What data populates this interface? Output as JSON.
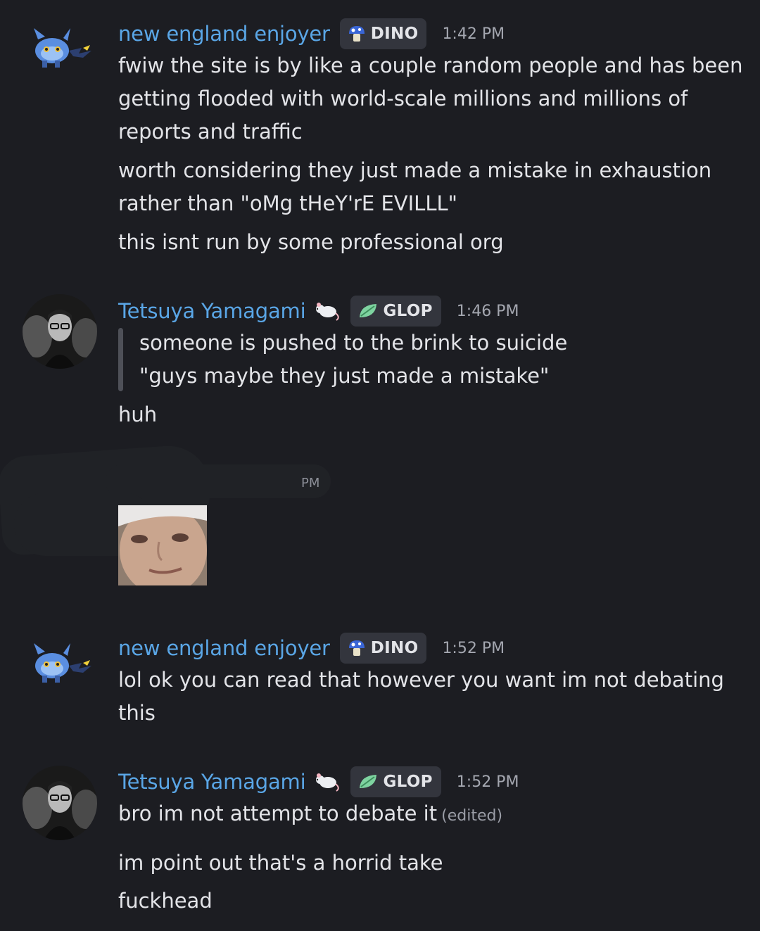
{
  "messages": [
    {
      "username": "new england enjoyer",
      "tag": "DINO",
      "time": "1:42 PM",
      "lines": [
        "fwiw the site is by like a couple random people and has been",
        "getting flooded with world-scale millions and millions of",
        "reports and traffic",
        "worth considering they just made a mistake in exhaustion",
        "rather than \"oMg tHeY'rE EVILLL\"",
        "this isnt run by some professional org"
      ]
    },
    {
      "username": "Tetsuya Yamagami",
      "tag": "GLOP",
      "time": "1:46 PM",
      "quote": [
        "someone is pushed to the brink to suicide",
        "\"guys maybe they just made a mistake\""
      ],
      "lines": [
        "huh"
      ]
    },
    {
      "redacted_time_fragment": "PM"
    },
    {
      "username": "new england enjoyer",
      "tag": "DINO",
      "time": "1:52 PM",
      "lines": [
        "lol ok you can read that however you want im not debating",
        "this"
      ]
    },
    {
      "username": "Tetsuya Yamagami",
      "tag": "GLOP",
      "time": "1:52 PM",
      "lines": [
        "bro im not attempt to debate it",
        "im point out that's a horrid take",
        "fuckhead"
      ],
      "edited": "(edited)"
    }
  ],
  "icons": {
    "dino_tag": "blue-mushroom-icon",
    "glop_tag": "green-leaf-icon",
    "rat": "white-rat-emoji",
    "avatar_a": "shinx-pokemon-sprite",
    "avatar_b": "man-with-glasses-photo"
  }
}
